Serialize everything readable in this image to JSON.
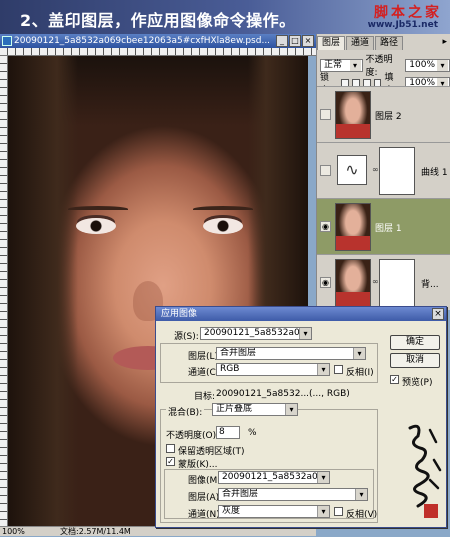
{
  "banner": {
    "title": "2、盖印图层，作应用图像命令操作。",
    "logo_cn": "脚本之家",
    "logo_url": "www.Jb51.net"
  },
  "document": {
    "title": "20090121_5a8532a069cbee12063a5#cxfHXla8ew.psd...",
    "minimize": "_",
    "maximize": "□",
    "close": "×",
    "zoom": "100%",
    "doc_info": "文档:2.57M/11.4M"
  },
  "layers_panel": {
    "tabs": [
      "图层",
      "通道",
      "路径"
    ],
    "menu": "▸",
    "blend_mode": "正常",
    "opacity_label": "不透明度:",
    "opacity_value": "100%",
    "lock_label": "锁定:",
    "fill_label": "填充:",
    "fill_value": "100%",
    "layers": [
      {
        "name": "图层 2",
        "type": "image",
        "visible": false,
        "selected": false
      },
      {
        "name": "曲线 1",
        "type": "adjustment",
        "visible": false,
        "selected": false
      },
      {
        "name": "图层 1",
        "type": "image",
        "visible": true,
        "selected": true
      },
      {
        "name": "背...",
        "type": "image-mask",
        "visible": true,
        "selected": false
      }
    ]
  },
  "dialog": {
    "title": "应用图像",
    "close": "×",
    "source_label": "源(S):",
    "source_value": "20090121_5a8532a069...",
    "layer_label": "图层(L):",
    "layer_value": "合并图层",
    "channel_label": "通道(C):",
    "channel_value": "RGB",
    "invert_label": "反相(I)",
    "target_label": "目标:",
    "target_value": "20090121_5a8532...(..., RGB)",
    "blending_label": "混合(B):",
    "blending_value": "正片叠底",
    "opacity_label": "不透明度(O):",
    "opacity_value": "8",
    "opacity_unit": "%",
    "preserve_transparency_label": "保留透明区域(T)",
    "mask_label": "蒙版(K)...",
    "mask_image_label": "图像(M):",
    "mask_image_value": "20090121_5a8532a069...",
    "mask_layer_label": "图层(A):",
    "mask_layer_value": "合并图层",
    "mask_channel_label": "通道(N):",
    "mask_channel_value": "灰度",
    "mask_invert_label": "反相(V)",
    "ok_label": "确定",
    "cancel_label": "取消",
    "preview_label": "预览(P)",
    "preview_checked": true,
    "mask_checked": true
  },
  "signature_text": "邪恶的人"
}
